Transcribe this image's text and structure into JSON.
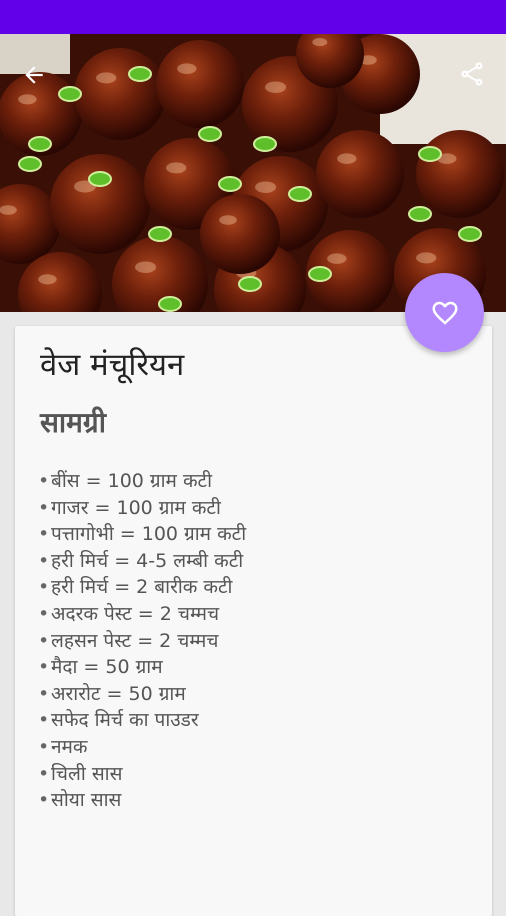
{
  "colors": {
    "status_bar": "#6200ea",
    "fab": "#b388ff",
    "card": "#f8f8f8",
    "background": "#e8e8e8"
  },
  "toolbar": {
    "back_icon": "arrow-back-icon",
    "share_icon": "share-icon"
  },
  "hero": {
    "image": "veg-manchurian-photo"
  },
  "fab": {
    "icon": "heart-outline-icon"
  },
  "recipe": {
    "title": "वेज मंचूरियन",
    "section_heading": "सामग्री",
    "bullet": "•",
    "ingredients": [
      "बींस = 100 ग्राम कटी",
      "गाजर = 100 ग्राम कटी",
      "पत्तागोभी = 100 ग्राम कटी",
      "हरी मिर्च = 4-5 लम्बी कटी",
      "हरी मिर्च = 2 बारीक कटी",
      "अदरक पेस्ट = 2 चम्मच",
      "लहसन पेस्ट = 2 चम्मच",
      "मैदा = 50 ग्राम",
      "अरारोट = 50 ग्राम",
      "सफेद मिर्च का पाउडर",
      "नमक",
      "चिली सास",
      "सोया सास"
    ]
  }
}
